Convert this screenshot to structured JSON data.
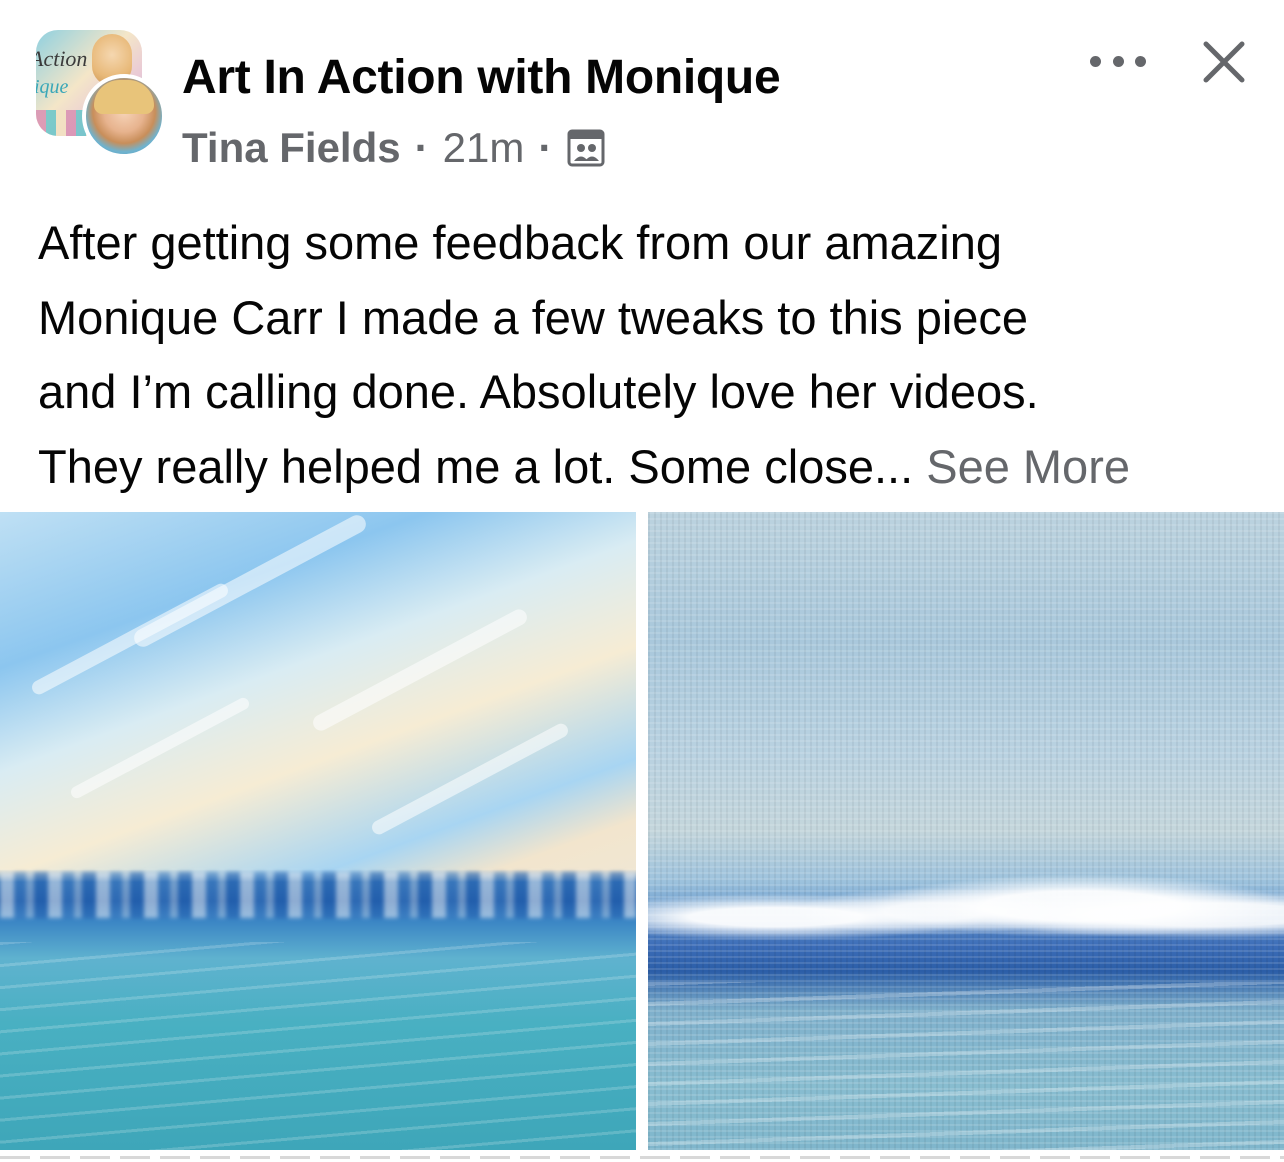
{
  "post": {
    "group_name": "Art In Action with Monique",
    "author": "Tina Fields",
    "separator": "·",
    "time": "21m",
    "audience_icon": "group-icon",
    "text_lines": [
      "After getting some feedback from our amazing",
      "Monique Carr I made a few tweaks to this piece",
      "and I’m calling done. Absolutely love her videos.",
      "They really helped me a lot. Some close..."
    ],
    "see_more": "See More"
  },
  "header_actions": {
    "more_icon": "more-horizontal-icon",
    "close_icon": "close-icon"
  },
  "photos": [
    {
      "subject": "ocean painting with sky streaks"
    },
    {
      "subject": "close-up of painted waves"
    }
  ],
  "colors": {
    "primary_text": "#050505",
    "secondary_text": "#65676b"
  }
}
